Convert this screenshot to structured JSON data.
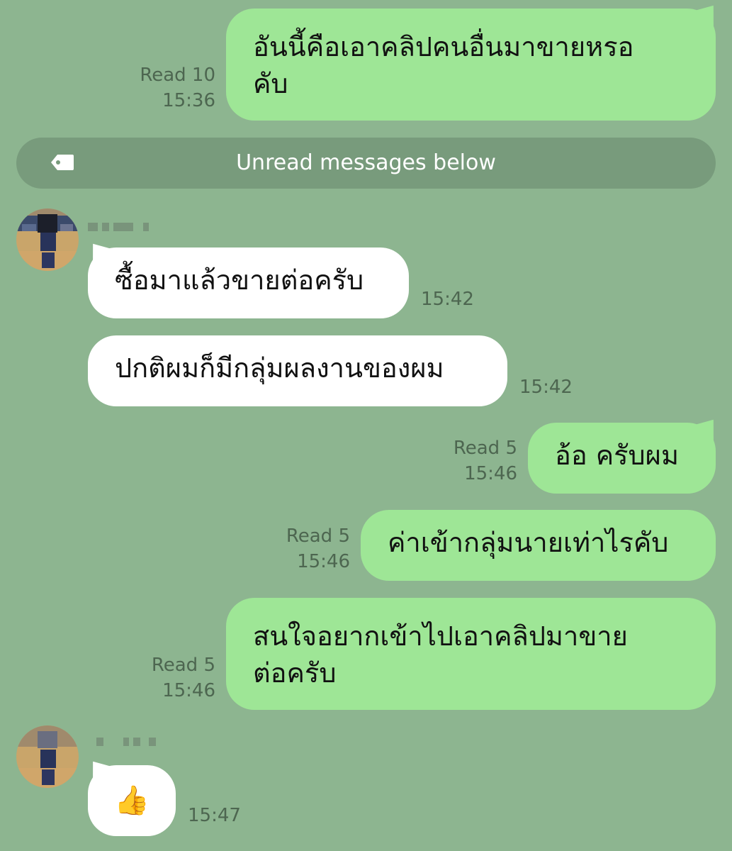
{
  "messages": [
    {
      "id": "m1",
      "direction": "outgoing",
      "lines": [
        "อันนี้คือเอาคลิปคนอื่นมาขายหรอ",
        "คับ"
      ],
      "read": "Read 10",
      "time": "15:36"
    },
    {
      "id": "m2",
      "direction": "incoming",
      "text": "ซื้อมาแล้วขายต่อครับ",
      "time": "15:42"
    },
    {
      "id": "m3",
      "direction": "incoming",
      "text": "ปกติผมก็มีกลุ่มผลงานของผม",
      "time": "15:42"
    },
    {
      "id": "m4",
      "direction": "outgoing",
      "text": "อ้อ ครับผม",
      "read": "Read 5",
      "time": "15:46"
    },
    {
      "id": "m5",
      "direction": "outgoing",
      "text": "ค่าเข้ากลุ่มนายเท่าไรคับ",
      "read": "Read 5",
      "time": "15:46"
    },
    {
      "id": "m6",
      "direction": "outgoing",
      "lines": [
        "สนใจอยากเข้าไปเอาคลิปมาขาย",
        "ต่อครับ"
      ],
      "read": "Read 5",
      "time": "15:46"
    },
    {
      "id": "m7",
      "direction": "incoming",
      "emoji": "👍",
      "time": "15:47"
    }
  ],
  "unread_banner": {
    "text": "Unread messages below",
    "icon": "tag-icon"
  },
  "colors": {
    "background": "#8db590",
    "outgoing_bubble": "#9ee696",
    "incoming_bubble": "#ffffff",
    "banner": "#789b7c"
  }
}
